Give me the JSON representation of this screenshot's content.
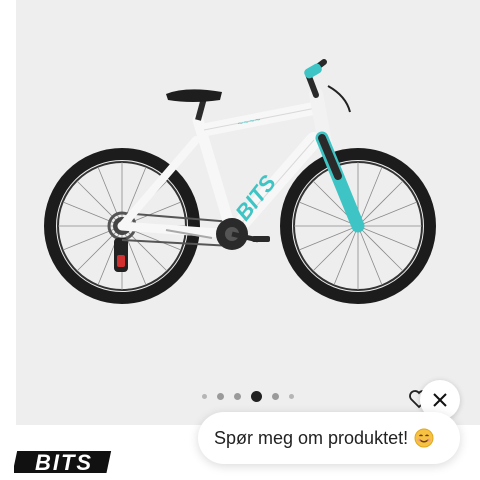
{
  "gallery": {
    "image_alt": "BITS kids bicycle, white with turquoise fork",
    "dots": {
      "count": 6,
      "active_index": 3
    },
    "close_icon": "close-icon",
    "favorite_icon": "heart-icon"
  },
  "brand": {
    "logo_text": "BITS"
  },
  "chat": {
    "prompt_text": "Spør meg om produktet!",
    "emoji_icon": "smiling-face-icon"
  },
  "colors": {
    "accent_teal": "#3ec4c4",
    "frame_white": "#f7f7f7",
    "tire_black": "#1c1c1c",
    "background": "#eeeeee"
  }
}
